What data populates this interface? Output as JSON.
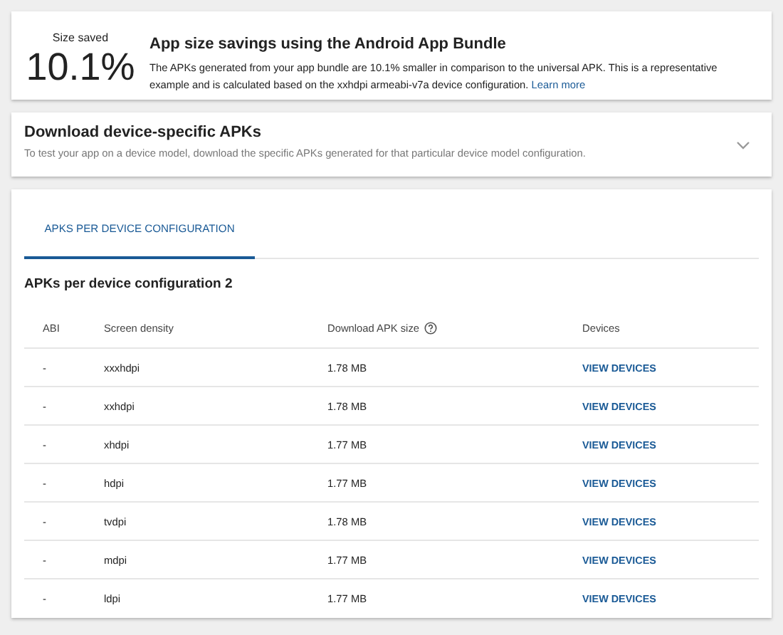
{
  "summary": {
    "label": "Size saved",
    "value": "10.1%",
    "title": "App size savings using the Android App Bundle",
    "description": "The APKs generated from your app bundle are 10.1% smaller in comparison to the universal APK. This is a representative example and is calculated based on the xxhdpi armeabi-v7a device configuration.",
    "link": "Learn more"
  },
  "download": {
    "title": "Download device-specific APKs",
    "description": "To test your app on a device model, download the specific APKs generated for that particular device model configuration.",
    "expanded": false
  },
  "tabs": [
    {
      "label": "APKS PER DEVICE CONFIGURATION",
      "selected": true
    }
  ],
  "table": {
    "title": "APKs per device configuration 2",
    "columns": [
      "ABI",
      "Screen density",
      "Download APK size",
      "Devices"
    ],
    "rows": [
      {
        "abi": "-",
        "density": "xxxhdpi",
        "size": "1.78 MB",
        "action": "VIEW DEVICES"
      },
      {
        "abi": "-",
        "density": "xxhdpi",
        "size": "1.78 MB",
        "action": "VIEW DEVICES"
      },
      {
        "abi": "-",
        "density": "xhdpi",
        "size": "1.77 MB",
        "action": "VIEW DEVICES"
      },
      {
        "abi": "-",
        "density": "hdpi",
        "size": "1.77 MB",
        "action": "VIEW DEVICES"
      },
      {
        "abi": "-",
        "density": "tvdpi",
        "size": "1.78 MB",
        "action": "VIEW DEVICES"
      },
      {
        "abi": "-",
        "density": "mdpi",
        "size": "1.77 MB",
        "action": "VIEW DEVICES"
      },
      {
        "abi": "-",
        "density": "ldpi",
        "size": "1.77 MB",
        "action": "VIEW DEVICES"
      }
    ]
  }
}
